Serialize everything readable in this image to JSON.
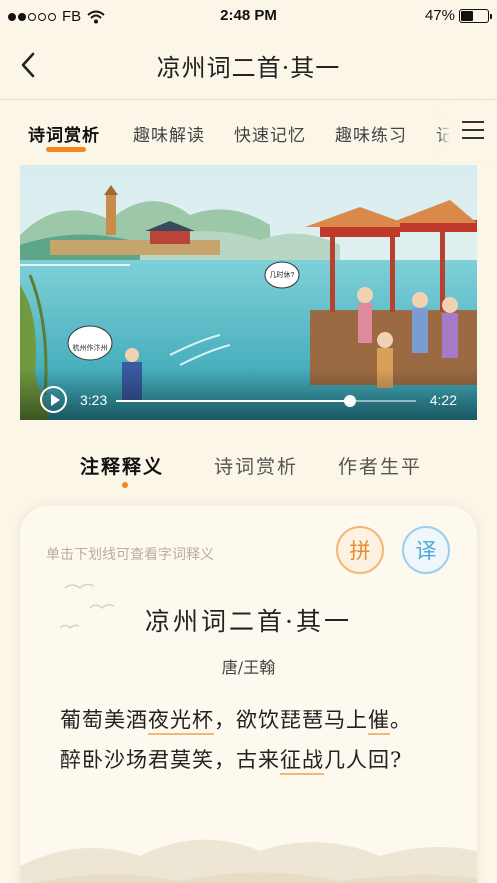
{
  "status_bar": {
    "carrier": "FB",
    "time": "2:48 PM",
    "battery": "47%",
    "battery_level": 0.47
  },
  "header": {
    "title": "凉州词二首·其一"
  },
  "tabs": [
    {
      "label": "诗词赏析",
      "active": true
    },
    {
      "label": "趣味解读",
      "active": false
    },
    {
      "label": "快速记忆",
      "active": false
    },
    {
      "label": "趣味练习",
      "active": false
    },
    {
      "label": "记",
      "active": false
    }
  ],
  "video": {
    "bubbles": [
      "几时休?",
      "杭州作汴州"
    ],
    "current_time": "3:23",
    "total_time": "4:22",
    "progress": 0.78
  },
  "sub_tabs": [
    {
      "label": "注释释义",
      "active": true
    },
    {
      "label": "诗词赏析",
      "active": false
    },
    {
      "label": "作者生平",
      "active": false
    }
  ],
  "card": {
    "hint": "单击下划线可查看字词释义",
    "pinyin_label": "拼",
    "translate_label": "译",
    "poem_title": "凉州词二首·其一",
    "poem_author": "唐/王翰",
    "lines": [
      {
        "segments": [
          {
            "t": "葡萄美酒",
            "u": false
          },
          {
            "t": "夜光杯",
            "u": true
          },
          {
            "t": "，欲饮琵琶马上",
            "u": false
          },
          {
            "t": "催",
            "u": true
          },
          {
            "t": "。",
            "u": false
          }
        ]
      },
      {
        "segments": [
          {
            "t": "醉卧沙场君莫笑，古来",
            "u": false
          },
          {
            "t": "征战",
            "u": true
          },
          {
            "t": "几人回?",
            "u": false
          }
        ]
      }
    ]
  },
  "colors": {
    "accent": "#f08a1c",
    "background": "#fbf6e8",
    "pinyin": "#e98b2c",
    "translate": "#4aa8de"
  }
}
